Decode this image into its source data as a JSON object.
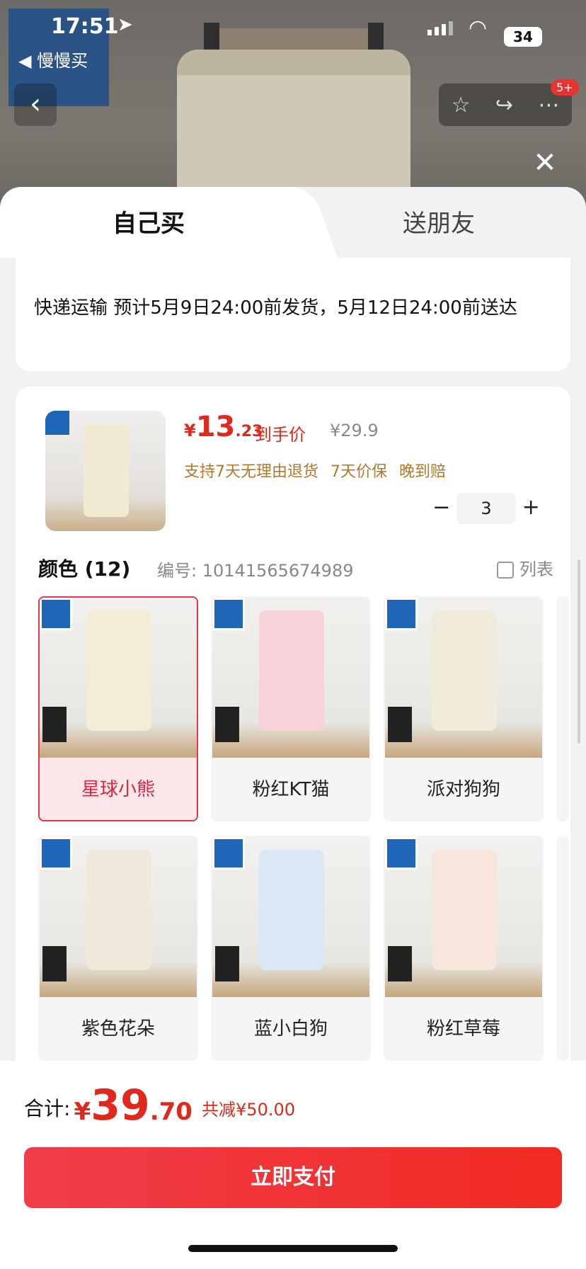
{
  "status_bar": {
    "time": "17:51",
    "back_app": "◀ 慢慢买",
    "battery": "34"
  },
  "colors": {
    "accent_red": "#e0281c",
    "selected_border": "#e23a4a",
    "guarantee_brown": "#b0782a",
    "pay_gradient": [
      "#f03d4a",
      "#f22a22"
    ]
  },
  "header": {
    "notification_badge": "5+"
  },
  "tabs": {
    "self_label": "自己买",
    "friend_label": "送朋友"
  },
  "delivery": {
    "text": "快递运输 预计5月9日24:00前发货，5月12日24:00前送达"
  },
  "product": {
    "price_symbol": "¥",
    "price_int": "13",
    "price_dec": ".23",
    "price_label": "到手价",
    "original_price": "¥29.9",
    "guarantees": "支持7天无理由退货 7天价保 晚到赔",
    "quantity": "3"
  },
  "colors_section": {
    "title": "颜色 (12)",
    "sku": "编号: 10141565674989",
    "list_label": "列表"
  },
  "variants": [
    {
      "name": "星球小熊",
      "selected": true,
      "pants_color": "#f3ecd6"
    },
    {
      "name": "粉红KT猫",
      "selected": false,
      "pants_color": "#f6d3d8"
    },
    {
      "name": "派对狗狗",
      "selected": false,
      "pants_color": "#f1ebd9"
    },
    {
      "name": "紫色花朵",
      "selected": false,
      "pants_color": "#efe9dc"
    },
    {
      "name": "蓝小白狗",
      "selected": false,
      "pants_color": "#d9e8f4"
    },
    {
      "name": "粉红草莓",
      "selected": false,
      "pants_color": "#f8e6dd"
    }
  ],
  "footer": {
    "total_label": "合计:",
    "total_symbol": "¥",
    "total_int": "39",
    "total_dec": ".70",
    "saving": "共减¥50.00",
    "pay_label": "立即支付"
  }
}
